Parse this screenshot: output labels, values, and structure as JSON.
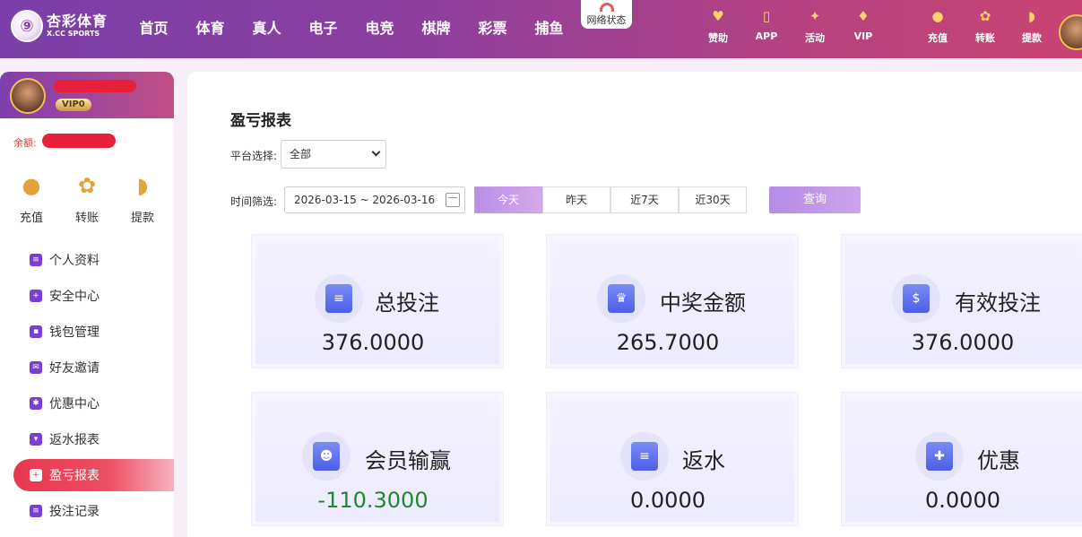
{
  "header": {
    "logo_cn": "杏彩体育",
    "logo_en": "X.CC SPORTS",
    "nav": [
      "首页",
      "体育",
      "真人",
      "电子",
      "电竞",
      "棋牌",
      "彩票",
      "捕鱼"
    ],
    "network_status": "网络状态",
    "icons": [
      {
        "label": "赞助",
        "icon": "handshake-icon"
      },
      {
        "label": "APP",
        "icon": "phone-icon"
      },
      {
        "label": "活动",
        "icon": "gift-icon"
      },
      {
        "label": "VIP",
        "icon": "diamond-icon"
      },
      {
        "label": "充值",
        "icon": "money-bag-icon"
      },
      {
        "label": "转账",
        "icon": "transfer-icon"
      },
      {
        "label": "提款",
        "icon": "fan-icon"
      }
    ]
  },
  "sidebar": {
    "vip": "VIP0",
    "balance_label": "余额:",
    "quick": [
      {
        "label": "充值",
        "icon": "money-bag-icon"
      },
      {
        "label": "转账",
        "icon": "transfer-icon"
      },
      {
        "label": "提款",
        "icon": "fan-icon"
      }
    ],
    "menu": [
      {
        "label": "个人资料",
        "icon": "profile-icon"
      },
      {
        "label": "安全中心",
        "icon": "shield-icon"
      },
      {
        "label": "钱包管理",
        "icon": "wallet-icon"
      },
      {
        "label": "好友邀请",
        "icon": "invite-icon"
      },
      {
        "label": "优惠中心",
        "icon": "ticket-icon"
      },
      {
        "label": "返水报表",
        "icon": "rebate-icon"
      },
      {
        "label": "盈亏报表",
        "icon": "report-icon",
        "active": true
      },
      {
        "label": "投注记录",
        "icon": "record-icon"
      }
    ]
  },
  "main": {
    "title": "盈亏报表",
    "platform_label": "平台选择:",
    "platform_value": "全部",
    "time_label": "时间筛选:",
    "date_range": "2026-03-15 ~ 2026-03-16",
    "ranges": [
      "今天",
      "昨天",
      "近7天",
      "近30天"
    ],
    "active_range": "今天",
    "query": "查询",
    "cards": [
      {
        "title": "总投注",
        "value": "376.0000",
        "icon": "bet-slip-icon"
      },
      {
        "title": "中奖金额",
        "value": "265.7000",
        "icon": "trophy-icon"
      },
      {
        "title": "有效投注",
        "value": "376.0000",
        "icon": "valid-bet-icon"
      },
      {
        "title": "会员输赢",
        "value": "-110.3000",
        "icon": "member-icon",
        "value_color": "#1e8a26"
      },
      {
        "title": "返水",
        "value": "0.0000",
        "icon": "rebate-doc-icon"
      },
      {
        "title": "优惠",
        "value": "0.0000",
        "icon": "bonus-icon"
      }
    ]
  }
}
